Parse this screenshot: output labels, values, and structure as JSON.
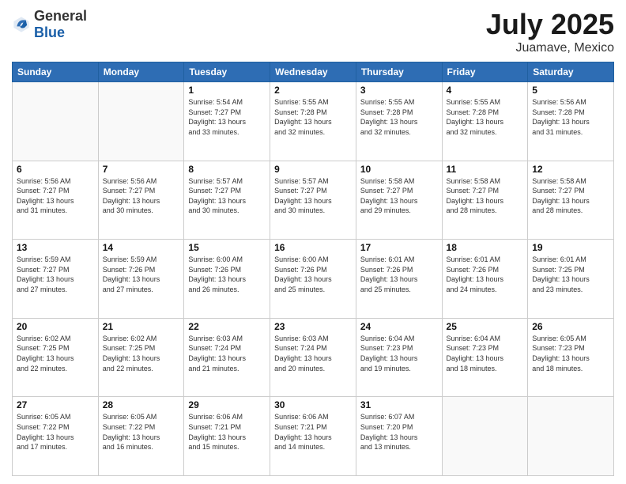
{
  "header": {
    "logo": {
      "general": "General",
      "blue": "Blue"
    },
    "title": "July 2025",
    "subtitle": "Juamave, Mexico"
  },
  "weekdays": [
    "Sunday",
    "Monday",
    "Tuesday",
    "Wednesday",
    "Thursday",
    "Friday",
    "Saturday"
  ],
  "weeks": [
    [
      {
        "day": "",
        "info": ""
      },
      {
        "day": "",
        "info": ""
      },
      {
        "day": "1",
        "info": "Sunrise: 5:54 AM\nSunset: 7:27 PM\nDaylight: 13 hours\nand 33 minutes."
      },
      {
        "day": "2",
        "info": "Sunrise: 5:55 AM\nSunset: 7:28 PM\nDaylight: 13 hours\nand 32 minutes."
      },
      {
        "day": "3",
        "info": "Sunrise: 5:55 AM\nSunset: 7:28 PM\nDaylight: 13 hours\nand 32 minutes."
      },
      {
        "day": "4",
        "info": "Sunrise: 5:55 AM\nSunset: 7:28 PM\nDaylight: 13 hours\nand 32 minutes."
      },
      {
        "day": "5",
        "info": "Sunrise: 5:56 AM\nSunset: 7:28 PM\nDaylight: 13 hours\nand 31 minutes."
      }
    ],
    [
      {
        "day": "6",
        "info": "Sunrise: 5:56 AM\nSunset: 7:27 PM\nDaylight: 13 hours\nand 31 minutes."
      },
      {
        "day": "7",
        "info": "Sunrise: 5:56 AM\nSunset: 7:27 PM\nDaylight: 13 hours\nand 30 minutes."
      },
      {
        "day": "8",
        "info": "Sunrise: 5:57 AM\nSunset: 7:27 PM\nDaylight: 13 hours\nand 30 minutes."
      },
      {
        "day": "9",
        "info": "Sunrise: 5:57 AM\nSunset: 7:27 PM\nDaylight: 13 hours\nand 30 minutes."
      },
      {
        "day": "10",
        "info": "Sunrise: 5:58 AM\nSunset: 7:27 PM\nDaylight: 13 hours\nand 29 minutes."
      },
      {
        "day": "11",
        "info": "Sunrise: 5:58 AM\nSunset: 7:27 PM\nDaylight: 13 hours\nand 28 minutes."
      },
      {
        "day": "12",
        "info": "Sunrise: 5:58 AM\nSunset: 7:27 PM\nDaylight: 13 hours\nand 28 minutes."
      }
    ],
    [
      {
        "day": "13",
        "info": "Sunrise: 5:59 AM\nSunset: 7:27 PM\nDaylight: 13 hours\nand 27 minutes."
      },
      {
        "day": "14",
        "info": "Sunrise: 5:59 AM\nSunset: 7:26 PM\nDaylight: 13 hours\nand 27 minutes."
      },
      {
        "day": "15",
        "info": "Sunrise: 6:00 AM\nSunset: 7:26 PM\nDaylight: 13 hours\nand 26 minutes."
      },
      {
        "day": "16",
        "info": "Sunrise: 6:00 AM\nSunset: 7:26 PM\nDaylight: 13 hours\nand 25 minutes."
      },
      {
        "day": "17",
        "info": "Sunrise: 6:01 AM\nSunset: 7:26 PM\nDaylight: 13 hours\nand 25 minutes."
      },
      {
        "day": "18",
        "info": "Sunrise: 6:01 AM\nSunset: 7:26 PM\nDaylight: 13 hours\nand 24 minutes."
      },
      {
        "day": "19",
        "info": "Sunrise: 6:01 AM\nSunset: 7:25 PM\nDaylight: 13 hours\nand 23 minutes."
      }
    ],
    [
      {
        "day": "20",
        "info": "Sunrise: 6:02 AM\nSunset: 7:25 PM\nDaylight: 13 hours\nand 22 minutes."
      },
      {
        "day": "21",
        "info": "Sunrise: 6:02 AM\nSunset: 7:25 PM\nDaylight: 13 hours\nand 22 minutes."
      },
      {
        "day": "22",
        "info": "Sunrise: 6:03 AM\nSunset: 7:24 PM\nDaylight: 13 hours\nand 21 minutes."
      },
      {
        "day": "23",
        "info": "Sunrise: 6:03 AM\nSunset: 7:24 PM\nDaylight: 13 hours\nand 20 minutes."
      },
      {
        "day": "24",
        "info": "Sunrise: 6:04 AM\nSunset: 7:23 PM\nDaylight: 13 hours\nand 19 minutes."
      },
      {
        "day": "25",
        "info": "Sunrise: 6:04 AM\nSunset: 7:23 PM\nDaylight: 13 hours\nand 18 minutes."
      },
      {
        "day": "26",
        "info": "Sunrise: 6:05 AM\nSunset: 7:23 PM\nDaylight: 13 hours\nand 18 minutes."
      }
    ],
    [
      {
        "day": "27",
        "info": "Sunrise: 6:05 AM\nSunset: 7:22 PM\nDaylight: 13 hours\nand 17 minutes."
      },
      {
        "day": "28",
        "info": "Sunrise: 6:05 AM\nSunset: 7:22 PM\nDaylight: 13 hours\nand 16 minutes."
      },
      {
        "day": "29",
        "info": "Sunrise: 6:06 AM\nSunset: 7:21 PM\nDaylight: 13 hours\nand 15 minutes."
      },
      {
        "day": "30",
        "info": "Sunrise: 6:06 AM\nSunset: 7:21 PM\nDaylight: 13 hours\nand 14 minutes."
      },
      {
        "day": "31",
        "info": "Sunrise: 6:07 AM\nSunset: 7:20 PM\nDaylight: 13 hours\nand 13 minutes."
      },
      {
        "day": "",
        "info": ""
      },
      {
        "day": "",
        "info": ""
      }
    ]
  ]
}
